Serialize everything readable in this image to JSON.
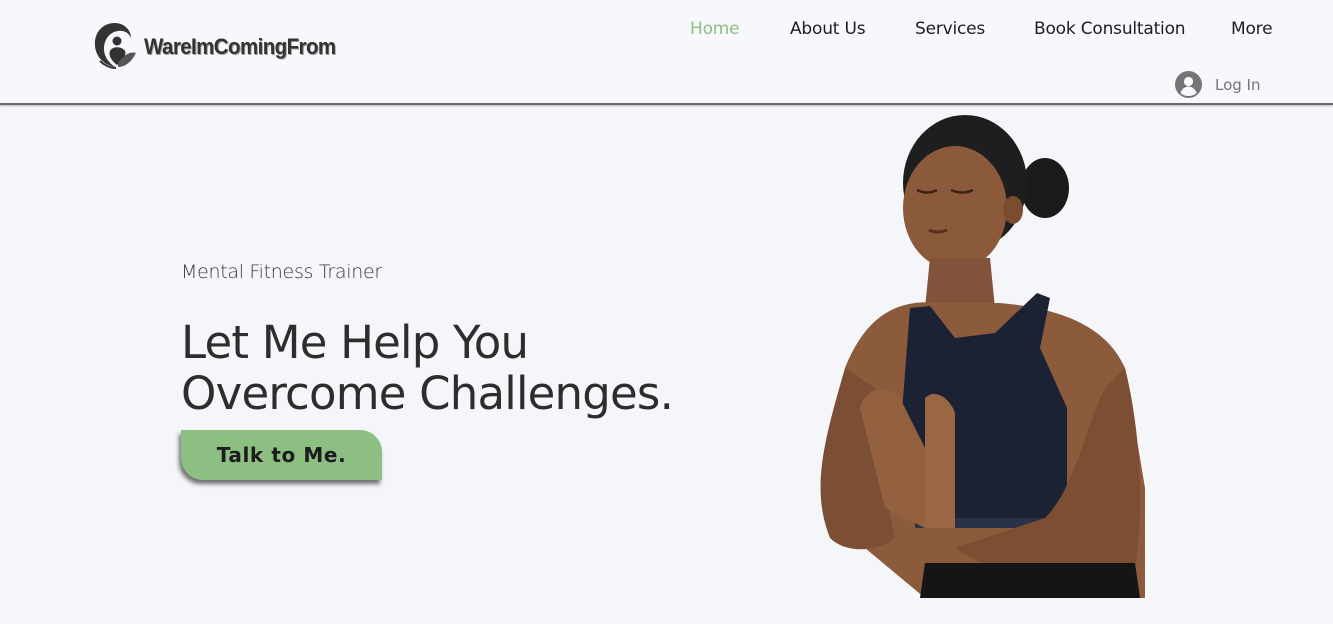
{
  "brand": {
    "name": "WareImComingFrom"
  },
  "nav": {
    "items": [
      {
        "label": "Home",
        "active": true
      },
      {
        "label": "About Us"
      },
      {
        "label": "Services"
      },
      {
        "label": "Book Consultation"
      },
      {
        "label": "More"
      }
    ],
    "login": {
      "label": "Log In",
      "icon": "user-avatar-icon"
    }
  },
  "hero": {
    "eyebrow": "Mental Fitness Trainer",
    "headline_line1": "Let Me Help You",
    "headline_line2": "Overcome Challenges.",
    "cta_label": "Talk to Me."
  },
  "colors": {
    "accent": "#8dbf82",
    "background": "#f5f6fa",
    "text": "#2d2d2d"
  }
}
